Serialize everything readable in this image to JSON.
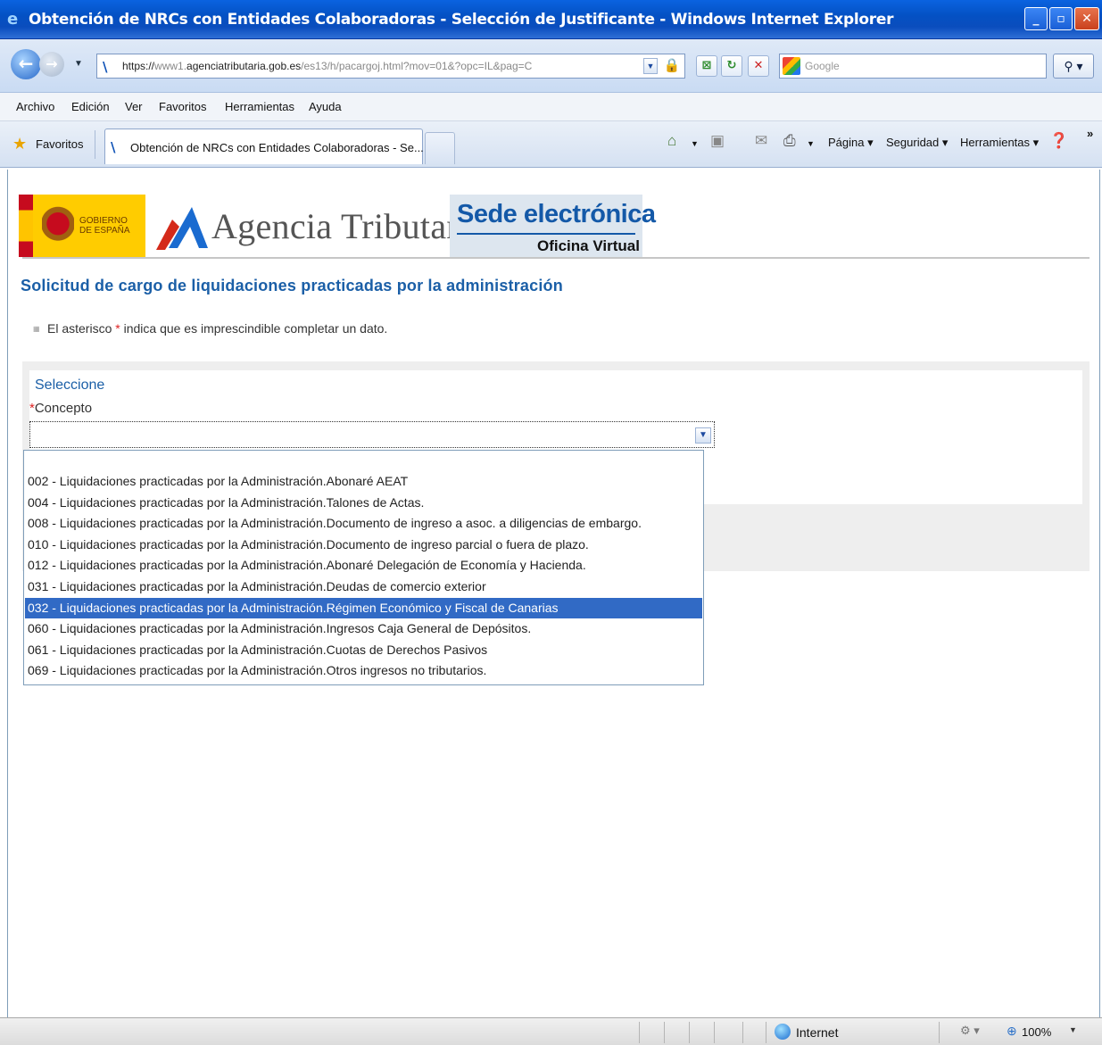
{
  "window": {
    "title": "Obtención de NRCs con Entidades Colaboradoras - Selección de Justificante - Windows Internet Explorer",
    "controls": {
      "minimize": "_",
      "maximize": "▫",
      "close": "✕"
    }
  },
  "address": {
    "url_https": "https://",
    "url_grey1": "www1.",
    "url_host": "agenciatributaria.gob.es",
    "url_path": "/es13/h/pacargoj.html?mov=01&?opc=IL&pag=C",
    "search_placeholder": "Google"
  },
  "menu": {
    "items": [
      "Archivo",
      "Edición",
      "Ver",
      "Favoritos",
      "Herramientas",
      "Ayuda"
    ]
  },
  "favbar": {
    "favorites_label": "Favoritos",
    "tab_label": "Obtención de NRCs con Entidades Colaboradoras - Se...",
    "commands": {
      "page": "Página ▾",
      "security": "Seguridad ▾",
      "tools": "Herramientas ▾"
    }
  },
  "header": {
    "gobierno_line1": "GOBIERNO",
    "gobierno_line2": "DE ESPAÑA",
    "agency": "Agencia Tributaria",
    "sede": "Sede electrónica",
    "oficina": "Oficina Virtual"
  },
  "page": {
    "title": "Solicitud de cargo de liquidaciones practicadas por la administración",
    "note_before": "El asterisco",
    "note_star": "*",
    "note_after": "indica que es imprescindible completar un dato."
  },
  "form": {
    "section_title": "Seleccione",
    "required_mark": "*",
    "concept_label": "Concepto",
    "concept_value": ""
  },
  "dropdown": {
    "options": [
      "002 - Liquidaciones practicadas por la Administración.Abonaré AEAT",
      "004 - Liquidaciones practicadas por la Administración.Talones de Actas.",
      "008 - Liquidaciones practicadas por la Administración.Documento de ingreso a asoc. a diligencias de embargo.",
      "010 - Liquidaciones practicadas por la Administración.Documento de ingreso parcial o fuera de plazo.",
      "012 - Liquidaciones practicadas por la Administración.Abonaré Delegación de Economía y Hacienda.",
      "031 - Liquidaciones practicadas por la Administración.Deudas de comercio exterior",
      "032 - Liquidaciones practicadas por la Administración.Régimen Económico y Fiscal de Canarias",
      "060 - Liquidaciones practicadas por la Administración.Ingresos Caja General de Depósitos.",
      "061 - Liquidaciones practicadas por la Administración.Cuotas de Derechos Pasivos",
      "069 - Liquidaciones practicadas por la Administración.Otros ingresos no tributarios."
    ],
    "highlighted_index": 6,
    "highlight_color": "#316ac5"
  },
  "status": {
    "zone": "Internet",
    "zoom": "100%"
  }
}
